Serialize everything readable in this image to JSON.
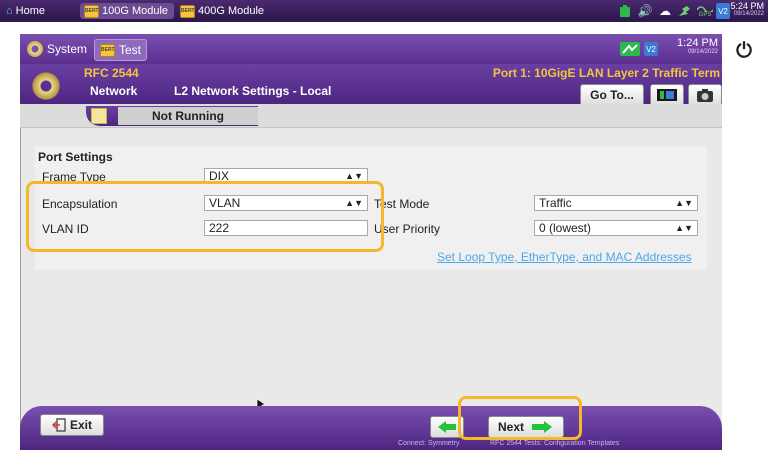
{
  "topbar": {
    "tabs": [
      "Home",
      "100G Module",
      "400G Module"
    ],
    "bert_badge": "BERT",
    "time": "5:24 PM",
    "date": "09/14/2022",
    "gps_label": "GPS",
    "v2_label": "V2"
  },
  "app": {
    "tabs": [
      "System",
      "Test"
    ],
    "time": "1:24 PM",
    "date": "09/14/2022",
    "test_name": "RFC 2544",
    "nav_label": "Network",
    "page_title": "L2 Network Settings - Local",
    "port_info": "Port 1: 10GigE LAN Layer 2 Traffic Term",
    "goto_label": "Go To...",
    "run_state": "Not Running"
  },
  "port_settings": {
    "title": "Port Settings",
    "frame_type_label": "Frame Type",
    "frame_type_value": "DIX",
    "encapsulation_label": "Encapsulation",
    "encapsulation_value": "VLAN",
    "vlan_id_label": "VLAN ID",
    "vlan_id_value": "222",
    "test_mode_label": "Test Mode",
    "test_mode_value": "Traffic",
    "user_priority_label": "User Priority",
    "user_priority_value": "0 (lowest)",
    "loop_link": "Set Loop Type, EtherType, and MAC Addresses"
  },
  "footer": {
    "exit_label": "Exit",
    "next_label": "Next",
    "connect_text": "Connect: Symmetry",
    "template_text": "RFC 2544 Tests: Configuration Templates"
  },
  "colors": {
    "purple": "#6a3fa2",
    "highlight": "#f5b82a",
    "link": "#4aa8e8",
    "arrow_green": "#22c33a"
  }
}
